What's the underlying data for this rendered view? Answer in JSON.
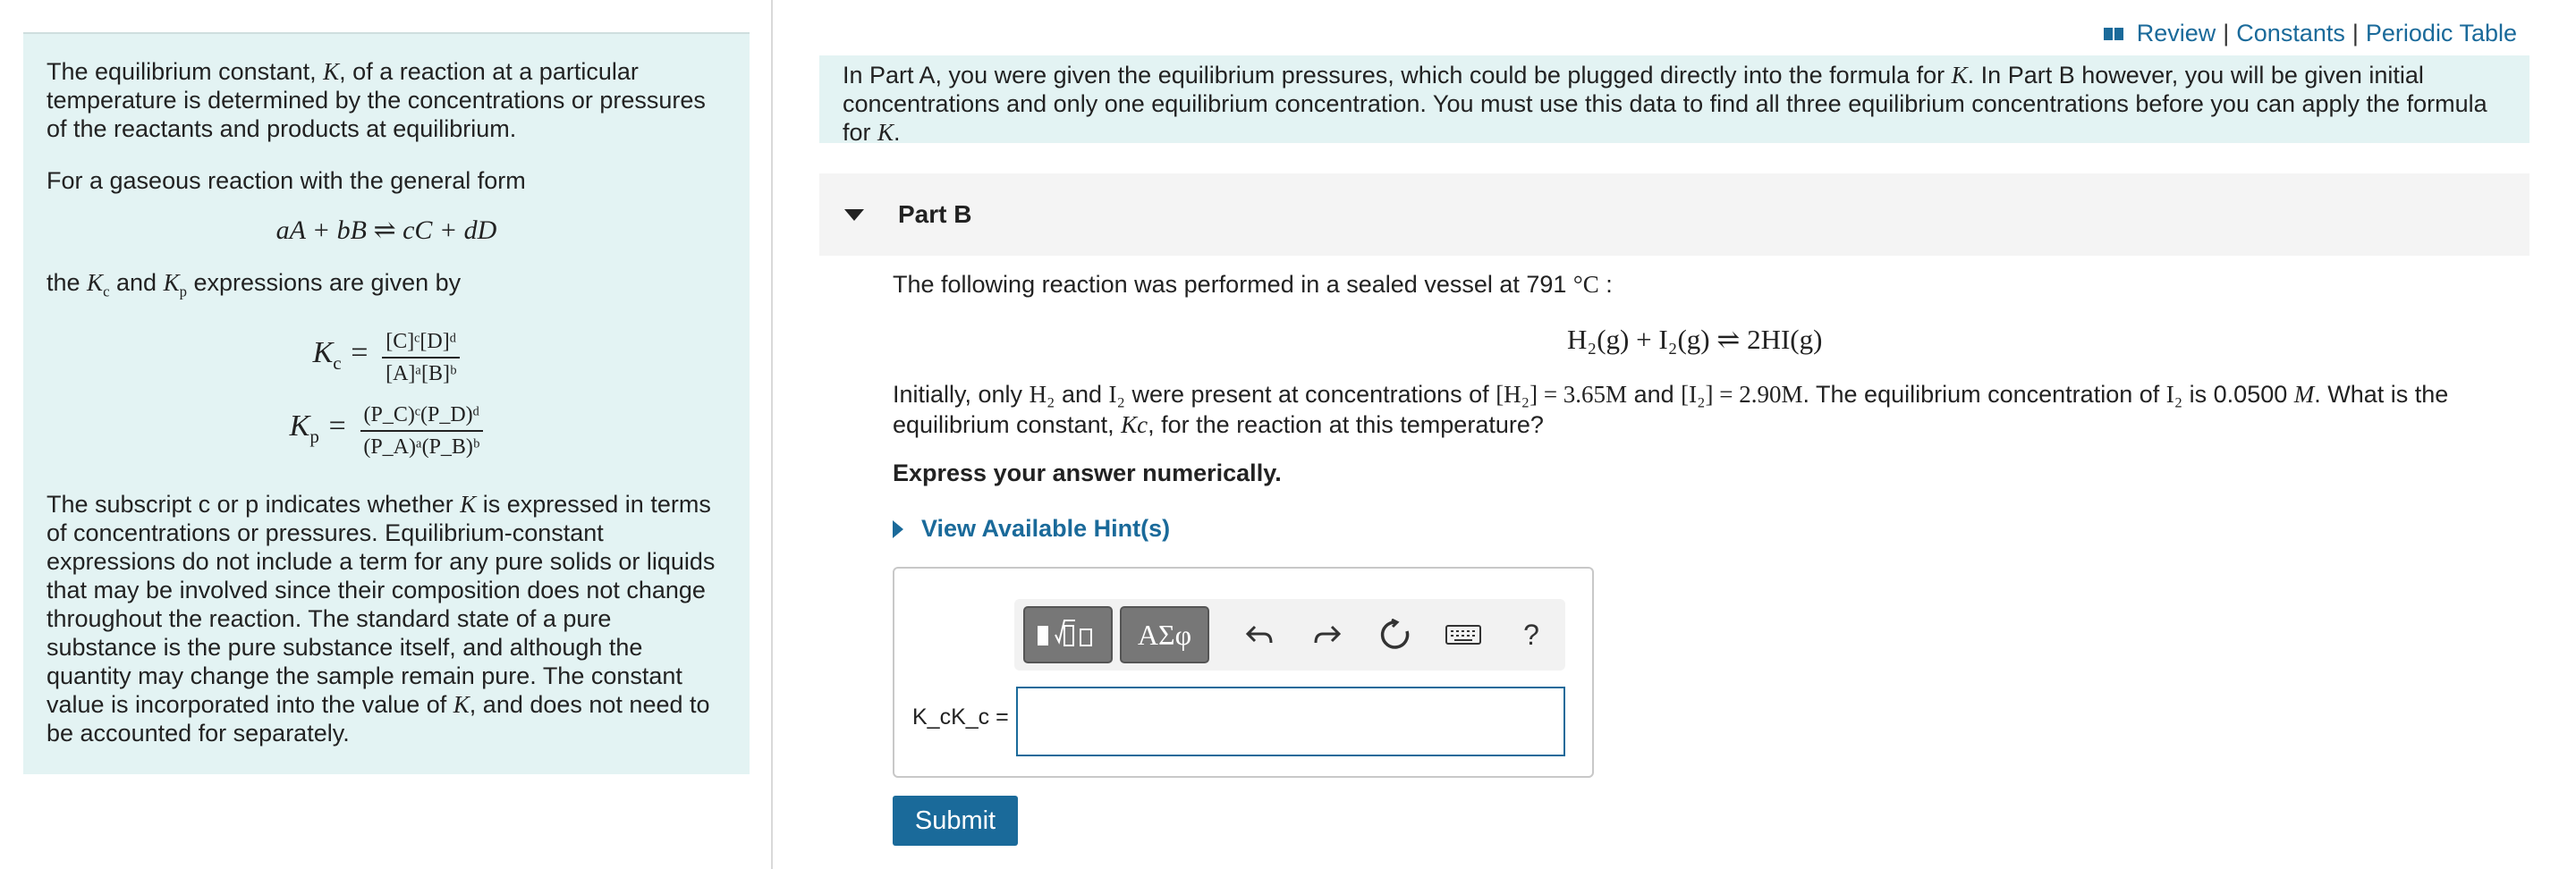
{
  "links": {
    "review": "Review",
    "constants": "Constants",
    "periodic_table": "Periodic Table",
    "separator": "|"
  },
  "left": {
    "p1_a": "The equilibrium constant, ",
    "p1_K": "K",
    "p1_b": ", of a reaction at a particular temperature is determined by the concentrations or pressures of the reactants and products at equilibrium.",
    "p2": "For a gaseous reaction with the general form",
    "general_eq": "aA + bB ⇌ cC + dD",
    "p3_a": "the ",
    "p3_b": " and ",
    "p3_c": " expressions are given by",
    "kc_num": "[C]ᶜ[D]ᵈ",
    "kc_den": "[A]ᵃ[B]ᵇ",
    "kp_num": "(P_C)ᶜ(P_D)ᵈ",
    "kp_den": "(P_A)ᵃ(P_B)ᵇ",
    "p4_a": "The subscript c or p indicates whether ",
    "p4_b": " is expressed in terms of concentrations or pressures. Equilibrium-constant expressions do not include a term for any pure solids or liquids that may be involved since their composition does not change throughout the reaction. The standard state of a pure substance is the pure substance itself, and although the quantity may change the sample remain pure. The constant value is incorporated into the value of ",
    "p4_c": ", and does not need to be accounted for separately."
  },
  "intro": {
    "text_a": "In Part A, you were given the equilibrium pressures, which could be plugged directly into the formula for ",
    "text_b": ". In Part B however, you will be given initial concentrations and only one equilibrium concentration. You must use this data to find all three equilibrium concentrations before you can apply the formula for ",
    "text_c": "."
  },
  "part_b": {
    "title": "Part B",
    "question_a": "The following reaction was performed in a sealed vessel at 791 ",
    "question_unit": "°C",
    "question_b": " :",
    "reaction": "H₂(g) + I₂(g) ⇌ 2HI(g)",
    "q2_a": "Initially, only ",
    "q2_h2": "H₂",
    "q2_b": " and ",
    "q2_i2": "I₂",
    "q2_c": " were present at concentrations of ",
    "q2_h2conc": "[H₂] = 3.65M",
    "q2_d": " and ",
    "q2_i2conc": "[I₂] = 2.90M",
    "q2_e": ". The equilibrium concentration of ",
    "q2_i2b": "I₂",
    "q2_f": " is 0.0500 ",
    "q2_M": "M",
    "q2_g": ". What is the equilibrium constant, ",
    "q2_Kc": "Kc",
    "q2_h": ", for the reaction at this temperature?",
    "instruction": "Express your answer numerically.",
    "hint": "View Available Hint(s)",
    "answer_label": "K_cK_c =",
    "answer_value": "",
    "submit": "Submit"
  },
  "toolbar": {
    "symbols": "ΑΣφ",
    "help": "?"
  }
}
